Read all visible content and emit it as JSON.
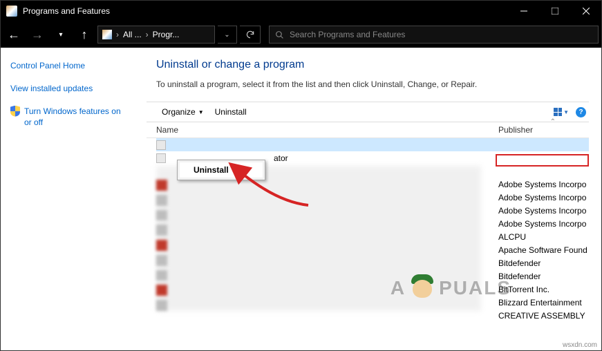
{
  "window": {
    "title": "Programs and Features"
  },
  "nav": {
    "crumb1": "All ...",
    "crumb2": "Progr...",
    "search_placeholder": "Search Programs and Features"
  },
  "sidebar": {
    "home": "Control Panel Home",
    "link1": "View installed updates",
    "link2": "Turn Windows features on or off"
  },
  "main": {
    "heading": "Uninstall or change a program",
    "subtitle": "To uninstall a program, select it from the list and then click Uninstall, Change, or Repair."
  },
  "toolbar": {
    "organize": "Organize",
    "uninstall": "Uninstall"
  },
  "columns": {
    "name": "Name",
    "publisher": "Publisher"
  },
  "context_menu": {
    "uninstall": "Uninstall"
  },
  "row2": {
    "trail": "ator"
  },
  "publishers": [
    "Adobe Systems Incorpo",
    "Adobe Systems Incorpo",
    "Adobe Systems Incorpo",
    "Adobe Systems Incorpo",
    "ALCPU",
    "Apache Software Found",
    "Bitdefender",
    "Bitdefender",
    "BitTorrent Inc.",
    "Blizzard Entertainment",
    "CREATIVE ASSEMBLY"
  ],
  "watermark": {
    "left": "A",
    "right": "PUALS"
  },
  "footer": "wsxdn.com"
}
